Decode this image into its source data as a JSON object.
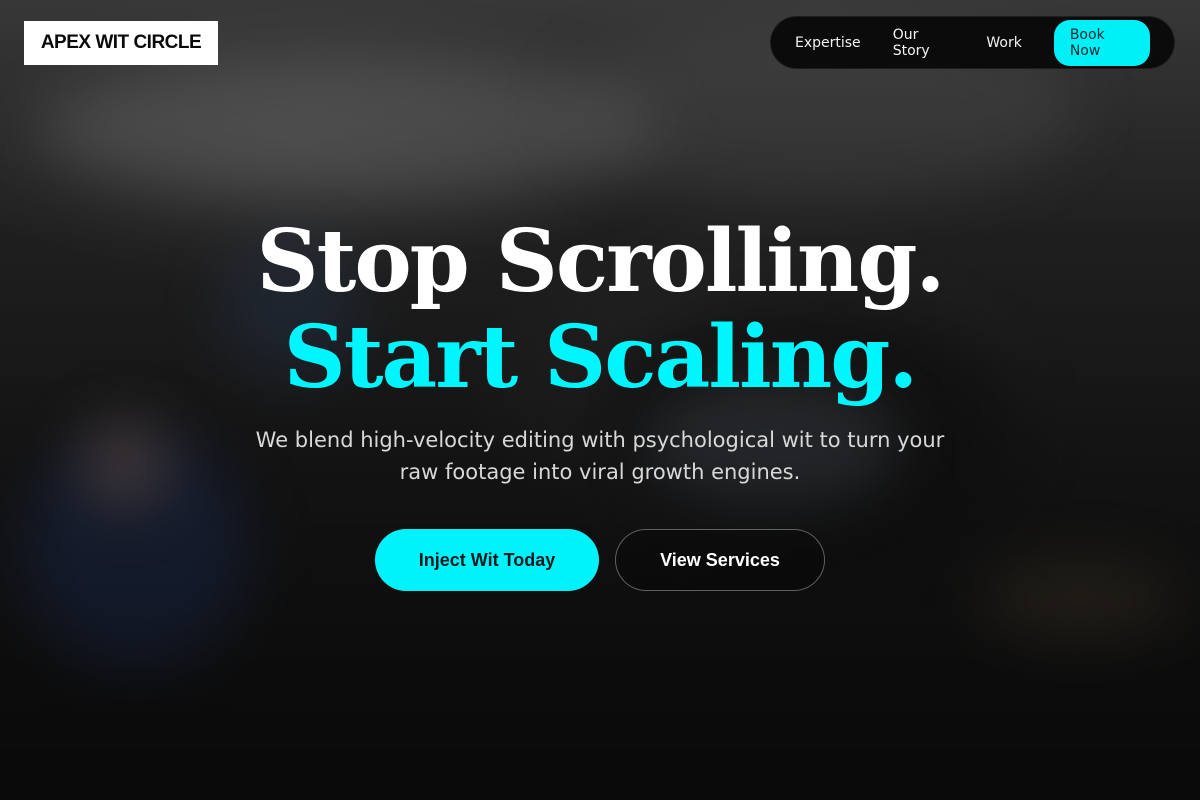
{
  "brand": {
    "name": "APEX WIT CIRCLE"
  },
  "nav": {
    "links": [
      "Expertise",
      "Our Story",
      "Work"
    ],
    "cta": "Book Now"
  },
  "hero": {
    "headline_line1": "Stop Scrolling.",
    "headline_line2": "Start Scaling.",
    "subtitle": "We blend high-velocity editing with psychological wit to turn your raw footage into viral growth engines.",
    "primary_button": "Inject Wit Today",
    "secondary_button": "View Services"
  },
  "colors": {
    "accent": "#00f3fa",
    "background": "#161616",
    "text": "#ffffff"
  }
}
